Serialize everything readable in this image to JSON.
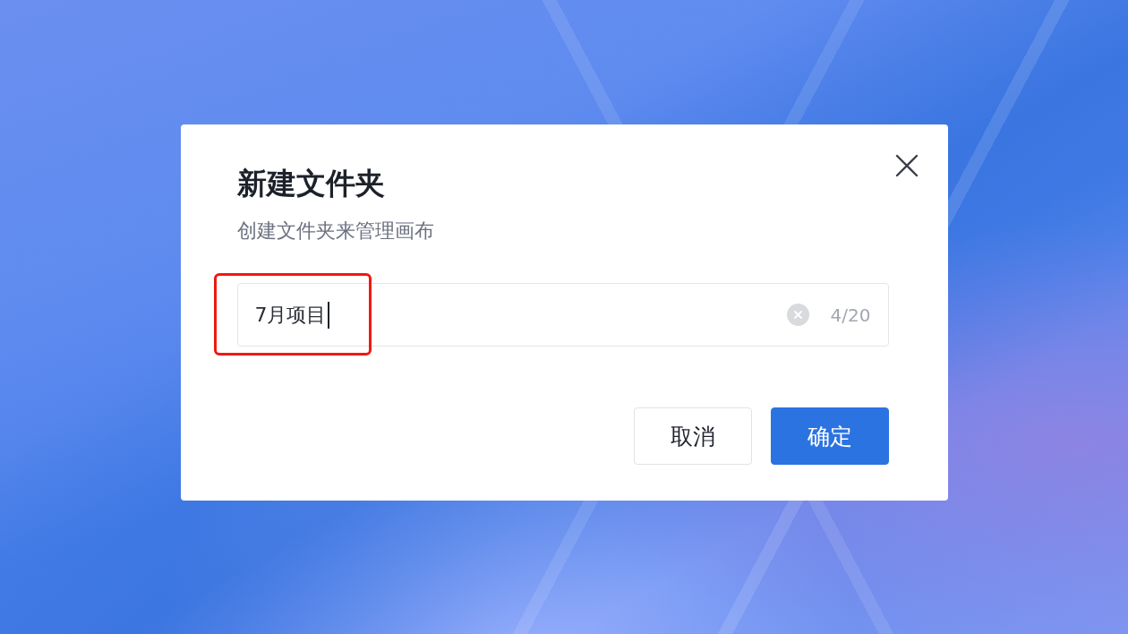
{
  "dialog": {
    "title": "新建文件夹",
    "subtitle": "创建文件夹来管理画布"
  },
  "input": {
    "value": "7月项目",
    "counter": "4/20",
    "focused": true,
    "highlighted": true
  },
  "buttons": [
    {
      "label": "取消",
      "kind": "secondary"
    },
    {
      "label": "确定",
      "kind": "primary"
    }
  ]
}
